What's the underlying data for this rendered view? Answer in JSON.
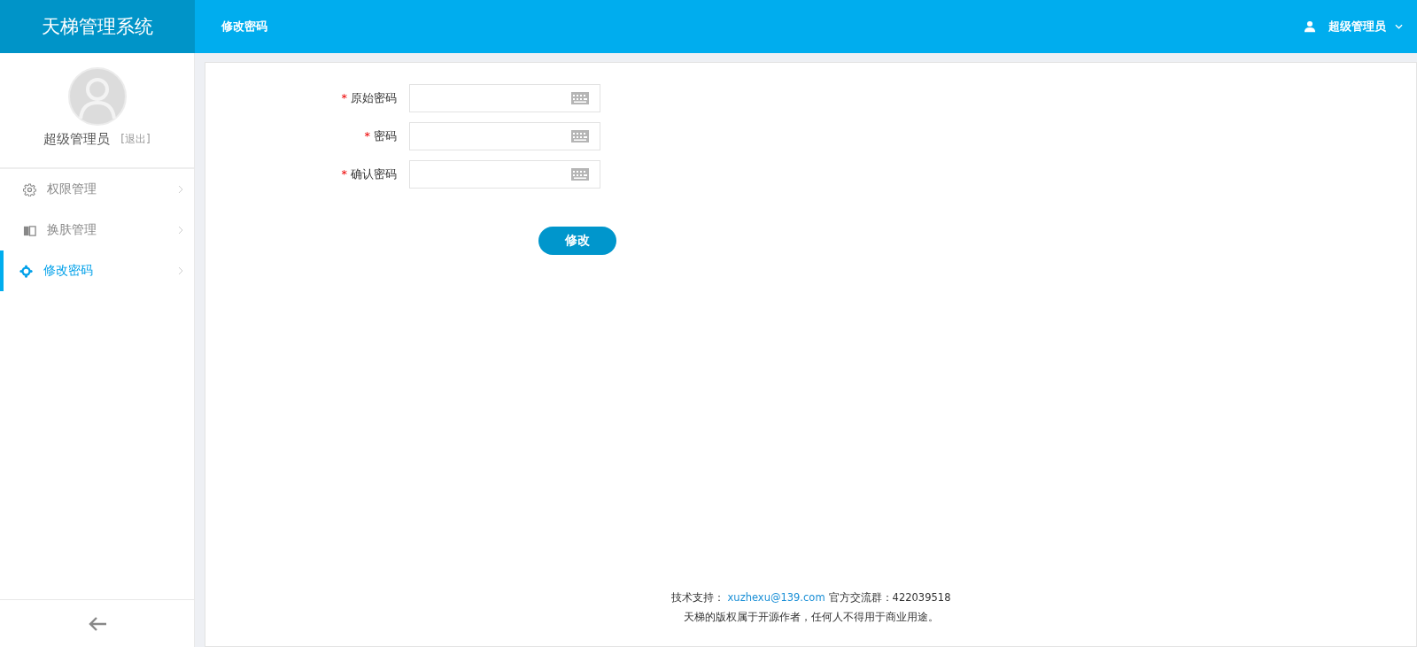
{
  "header": {
    "logo": "天梯管理系统",
    "page_title": "修改密码",
    "user": "超级管理员"
  },
  "sidebar": {
    "user_name": "超级管理员",
    "logout": "[退出]",
    "items": [
      {
        "label": "权限管理",
        "kind": "gear",
        "selected": false
      },
      {
        "label": "换肤管理",
        "kind": "book",
        "selected": false
      },
      {
        "label": "修改密码",
        "kind": "flower",
        "selected": true
      }
    ]
  },
  "form": {
    "fields": [
      {
        "required_mark": "*",
        "label": "原始密码"
      },
      {
        "required_mark": "*",
        "label": "密码"
      },
      {
        "required_mark": "*",
        "label": "确认密码"
      }
    ],
    "submit": "修改"
  },
  "footer": {
    "support_label": "技术支持：",
    "support_email": "xuzhexu@139.com",
    "group": "官方交流群：422039518",
    "copyright": "天梯的版权属于开源作者，任何人不得用于商业用途。"
  }
}
